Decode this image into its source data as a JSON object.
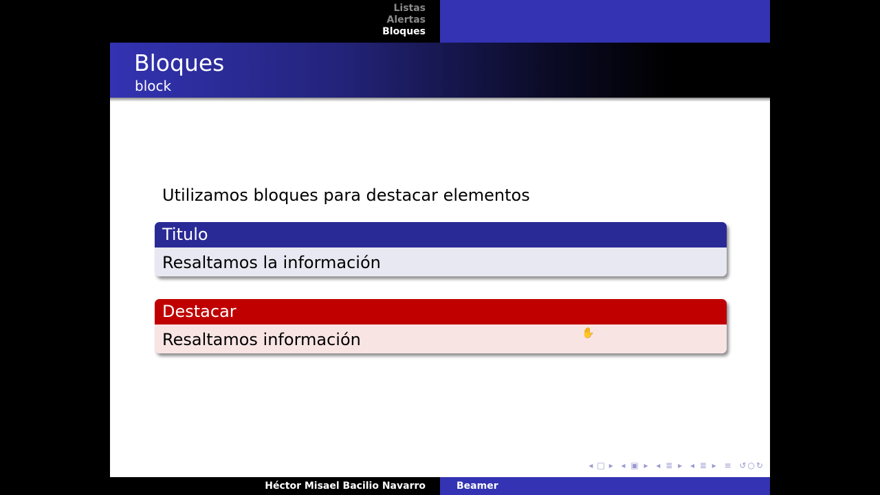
{
  "header": {
    "sections": [
      {
        "label": "Listas",
        "active": false
      },
      {
        "label": "Alertas",
        "active": false
      },
      {
        "label": "Bloques",
        "active": true
      }
    ]
  },
  "frame": {
    "title": "Bloques",
    "subtitle": "block"
  },
  "content": {
    "intro": "Utilizamos bloques para destacar elementos",
    "block_standard": {
      "title": "Titulo",
      "body": "Resaltamos la información",
      "title_color": "#2a2a96",
      "body_color": "#e8e8f2"
    },
    "block_alert": {
      "title": "Destacar",
      "body": "Resaltamos información",
      "title_color": "#c00000",
      "body_color": "#f9e4e4"
    }
  },
  "nav_icons": [
    "arrow-left-icon",
    "frame-icon",
    "arrow-right-icon",
    "subsection-icon",
    "section-icon",
    "document-icon",
    "search-icon"
  ],
  "footer": {
    "author": "Héctor Misael Bacilio Navarro",
    "title": "Beamer"
  },
  "colors": {
    "accent": "#3333b3",
    "background": "#000000"
  }
}
